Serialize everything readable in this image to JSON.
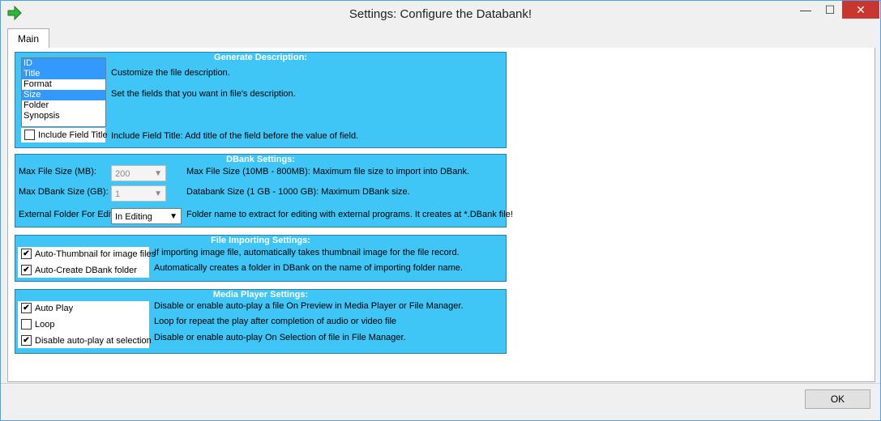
{
  "window": {
    "title": "Settings: Configure the Databank!"
  },
  "tabs": [
    {
      "label": "Main"
    }
  ],
  "generate": {
    "title": "Generate Description:",
    "fields": [
      {
        "label": "ID",
        "selected": true
      },
      {
        "label": "Title",
        "selected": true
      },
      {
        "label": "Format",
        "selected": false
      },
      {
        "label": "Size",
        "selected": true
      },
      {
        "label": "Folder",
        "selected": false
      },
      {
        "label": "Synopsis",
        "selected": false
      }
    ],
    "desc1": "Customize the file description.",
    "desc2": "Set the fields that you want in file's description.",
    "include_label": "Include Field Title",
    "include_desc": "Include Field Title: Add title of the field before the value of field."
  },
  "dbank": {
    "title": "DBank Settings:",
    "max_file_label": "Max File Size (MB):",
    "max_file_value": "200",
    "max_file_desc": "Max File Size (10MB - 800MB): Maximum file size to import into DBank.",
    "max_dbank_label": "Max DBank Size (GB):",
    "max_dbank_value": "1",
    "max_dbank_desc": "Databank Size (1 GB - 1000 GB): Maximum DBank size.",
    "ext_label": "External Folder For Edit",
    "ext_value": "In Editing",
    "ext_desc": "Folder name to extract for editing with external programs. It creates at *.DBank file!"
  },
  "import": {
    "title": "File Importing Settings:",
    "thumb_label": "Auto-Thumbnail for image files",
    "thumb_desc": "If importing image file, automatically takes thumbnail image for the file record.",
    "folder_label": "Auto-Create DBank folder",
    "folder_desc": "Automatically creates a folder in DBank on the name of importing folder name."
  },
  "media": {
    "title": "Media Player Settings:",
    "autoplay_label": "Auto Play",
    "autoplay_desc": "Disable or enable auto-play a file On Preview in Media Player or File Manager.",
    "loop_label": "Loop",
    "loop_desc": "Loop for repeat the play after completion of audio or video file",
    "disable_label": "Disable auto-play at selection",
    "disable_desc": "Disable or enable auto-play On Selection of file in File Manager."
  },
  "buttons": {
    "ok": "OK"
  },
  "glyphs": {
    "check": "✔",
    "arrow": "▼",
    "min": "—",
    "max": "☐",
    "close": "✕"
  },
  "colors": {
    "group_bg": "#3fc5f6",
    "selection": "#3399ff",
    "close": "#c7372f"
  }
}
